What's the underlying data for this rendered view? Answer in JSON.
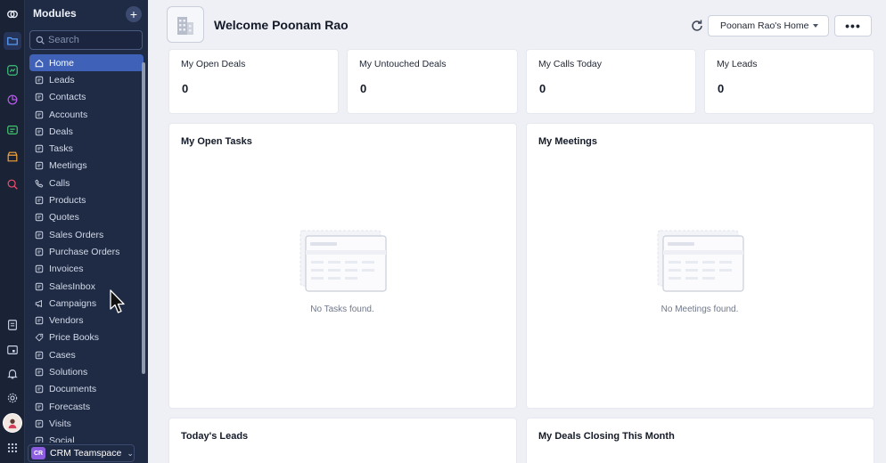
{
  "rail": {
    "icons": [
      "crm-logo-icon",
      "folder-icon",
      "analytics-icon",
      "pie-chart-icon",
      "cart-icon",
      "store-icon",
      "search-analytics-icon",
      "notes-icon",
      "calendar-widget-icon",
      "bell-icon",
      "settings-icon",
      "user-avatar",
      "apps-grid-icon"
    ]
  },
  "modules": {
    "header": "Modules",
    "add_label": "+",
    "search_placeholder": "Search",
    "items": [
      {
        "label": "Home",
        "icon": "home-icon",
        "active": true
      },
      {
        "label": "Leads",
        "icon": "leads-icon"
      },
      {
        "label": "Contacts",
        "icon": "contacts-icon"
      },
      {
        "label": "Accounts",
        "icon": "accounts-icon"
      },
      {
        "label": "Deals",
        "icon": "deals-icon"
      },
      {
        "label": "Tasks",
        "icon": "tasks-icon"
      },
      {
        "label": "Meetings",
        "icon": "meetings-icon"
      },
      {
        "label": "Calls",
        "icon": "phone-icon"
      },
      {
        "label": "Products",
        "icon": "products-icon"
      },
      {
        "label": "Quotes",
        "icon": "quotes-icon"
      },
      {
        "label": "Sales Orders",
        "icon": "sales-orders-icon"
      },
      {
        "label": "Purchase Orders",
        "icon": "purchase-orders-icon"
      },
      {
        "label": "Invoices",
        "icon": "invoices-icon"
      },
      {
        "label": "SalesInbox",
        "icon": "inbox-icon"
      },
      {
        "label": "Campaigns",
        "icon": "megaphone-icon"
      },
      {
        "label": "Vendors",
        "icon": "vendors-icon"
      },
      {
        "label": "Price Books",
        "icon": "price-tag-icon"
      },
      {
        "label": "Cases",
        "icon": "cases-icon"
      },
      {
        "label": "Solutions",
        "icon": "solutions-icon"
      },
      {
        "label": "Documents",
        "icon": "documents-icon"
      },
      {
        "label": "Forecasts",
        "icon": "forecasts-icon"
      },
      {
        "label": "Visits",
        "icon": "visits-icon"
      },
      {
        "label": "Social",
        "icon": "social-icon"
      }
    ],
    "team_badge": "CR",
    "team_name": "CRM Teamspace"
  },
  "header": {
    "welcome": "Welcome Poonam Rao",
    "home_select": "Poonam Rao's Home",
    "more_label": "•••"
  },
  "stats": [
    {
      "title": "My Open Deals",
      "value": "0"
    },
    {
      "title": "My Untouched Deals",
      "value": "0"
    },
    {
      "title": "My Calls Today",
      "value": "0"
    },
    {
      "title": "My Leads",
      "value": "0"
    }
  ],
  "widgets": {
    "open_tasks": {
      "title": "My Open Tasks",
      "empty": "No Tasks found."
    },
    "meetings": {
      "title": "My Meetings",
      "empty": "No Meetings found."
    },
    "todays_leads": {
      "title": "Today's Leads"
    },
    "deals_closing": {
      "title": "My Deals Closing This Month"
    }
  },
  "colors": {
    "sidebar_bg": "#1f2a44",
    "rail_bg": "#1a2236",
    "active_item": "#3f62b8",
    "main_bg": "#eef0f6",
    "card_bg": "#ffffff"
  }
}
